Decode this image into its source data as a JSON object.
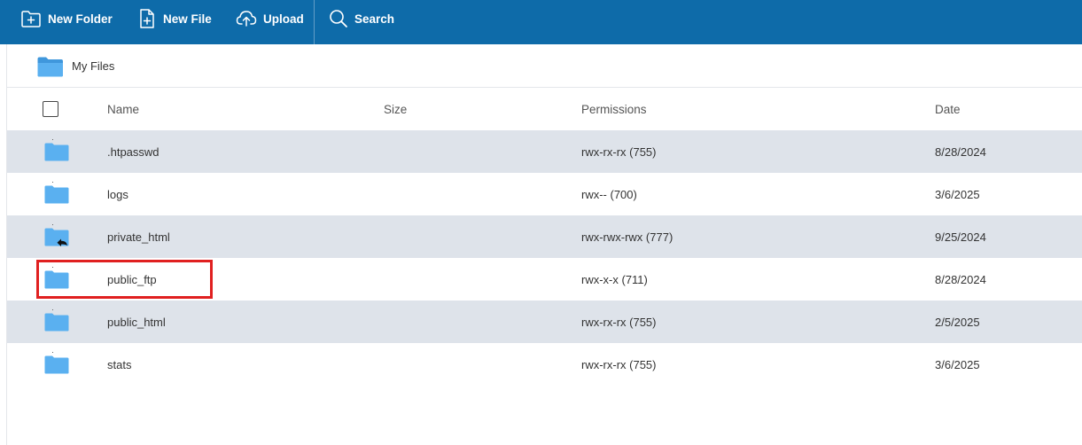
{
  "toolbar": {
    "new_folder_label": "New Folder",
    "new_file_label": "New File",
    "upload_label": "Upload",
    "search_label": "Search",
    "background_color": "#0e6ba9"
  },
  "breadcrumb": {
    "label": "My Files",
    "icon": "folder-icon"
  },
  "table": {
    "columns": {
      "name": "Name",
      "size": "Size",
      "permissions": "Permissions",
      "date": "Date"
    },
    "rows": [
      {
        "name": ".htpasswd",
        "size": "",
        "permissions": "rwx-rx-rx (755)",
        "date": "8/28/2024",
        "icon": "folder-icon",
        "shaded": true
      },
      {
        "name": "logs",
        "size": "",
        "permissions": "rwx-- (700)",
        "date": "3/6/2025",
        "icon": "folder-icon",
        "shaded": false
      },
      {
        "name": "private_html",
        "size": "",
        "permissions": "rwx-rwx-rwx (777)",
        "date": "9/25/2024",
        "icon": "folder-shortcut-icon",
        "shaded": true
      },
      {
        "name": "public_ftp",
        "size": "",
        "permissions": "rwx-x-x (711)",
        "date": "8/28/2024",
        "icon": "folder-icon",
        "shaded": false
      },
      {
        "name": "public_html",
        "size": "",
        "permissions": "rwx-rx-rx (755)",
        "date": "2/5/2025",
        "icon": "folder-icon",
        "shaded": true,
        "highlighted": true
      },
      {
        "name": "stats",
        "size": "",
        "permissions": "rwx-rx-rx (755)",
        "date": "3/6/2025",
        "icon": "folder-icon",
        "shaded": false
      }
    ]
  },
  "colors": {
    "row_shade": "#dee3ea",
    "folder": "#5ab0f0",
    "highlight_border": "#e02020"
  }
}
